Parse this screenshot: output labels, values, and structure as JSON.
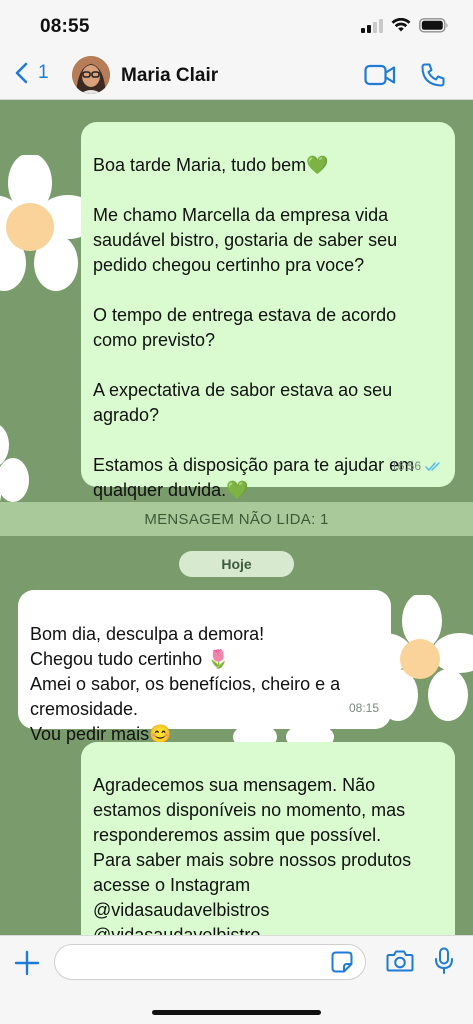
{
  "status_bar": {
    "time": "08:55"
  },
  "header": {
    "back_count": "1",
    "contact_name": "Maria Clair"
  },
  "messages": [
    {
      "direction": "out",
      "text": "Boa tarde Maria, tudo bem💚\n\nMe chamo Marcella da empresa vida saudável bistro, gostaria de saber seu pedido chegou certinho pra voce?\n\nO tempo de entrega estava de acordo como previsto?\n\nA expectativa de sabor estava ao seu agrado?\n\nEstamos à disposição para te ajudar em qualquer duvida.💚",
      "time": "16:56",
      "status": "read"
    },
    {
      "direction": "in",
      "text": "Bom dia,  desculpa a demora!\nChegou tudo certinho 🌷\nAmei o sabor, os benefícios, cheiro e a cremosidade.\nVou pedir mais😊",
      "time": "08:15"
    },
    {
      "direction": "out",
      "text": "Agradecemos sua mensagem. Não estamos disponíveis no momento, mas responderemos assim que possível.\nPara saber mais sobre nossos produtos acesse o Instagram\n@vidasaudavelbistros\n@vidasaudavelbistro\nSite: https://...",
      "time": ""
    }
  ],
  "unread_banner": "MENSAGEM NÃO LIDA: 1",
  "day_separator": "Hoje",
  "input": {
    "value": "",
    "placeholder": ""
  },
  "colors": {
    "wallpaper": "#7a9b6c",
    "outgoing_bubble": "#d9fbcf",
    "incoming_bubble": "#ffffff",
    "accent": "#1f7bd6",
    "read_ticks": "#53bdeb"
  },
  "icons": [
    "back-chevron-icon",
    "video-call-icon",
    "phone-icon",
    "plus-icon",
    "sticker-icon",
    "camera-icon",
    "microphone-icon",
    "wifi-icon",
    "battery-icon",
    "signal-icon"
  ]
}
